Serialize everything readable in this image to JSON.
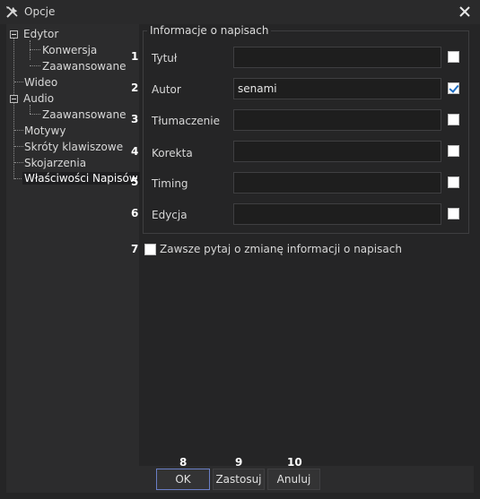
{
  "window": {
    "title": "Opcje"
  },
  "tree": {
    "items": [
      {
        "label": "Edytor"
      },
      {
        "label": "Konwersja"
      },
      {
        "label": "Zaawansowane"
      },
      {
        "label": "Wideo"
      },
      {
        "label": "Audio"
      },
      {
        "label": "Zaawansowane"
      },
      {
        "label": "Motywy"
      },
      {
        "label": "Skróty klawiszowe"
      },
      {
        "label": "Skojarzenia"
      },
      {
        "label": "Właściwości Napisów"
      }
    ],
    "selected": "Właściwości Napisów"
  },
  "group": {
    "title": "Informacje o napisach",
    "fields": [
      {
        "num": "1",
        "label": "Tytuł",
        "value": "",
        "checked": false
      },
      {
        "num": "2",
        "label": "Autor",
        "value": "senami",
        "checked": true
      },
      {
        "num": "3",
        "label": "Tłumaczenie",
        "value": "",
        "checked": false
      },
      {
        "num": "4",
        "label": "Korekta",
        "value": "",
        "checked": false
      },
      {
        "num": "5",
        "label": "Timing",
        "value": "",
        "checked": false
      },
      {
        "num": "6",
        "label": "Edycja",
        "value": "",
        "checked": false
      }
    ]
  },
  "always_ask": {
    "num": "7",
    "label": "Zawsze pytaj o zmianę informacji o napisach",
    "checked": false
  },
  "buttons": [
    {
      "num": "8",
      "label": "OK"
    },
    {
      "num": "9",
      "label": "Zastosuj"
    },
    {
      "num": "10",
      "label": "Anuluj"
    }
  ],
  "icons": {
    "app": "tools-icon",
    "close": "close-icon"
  }
}
